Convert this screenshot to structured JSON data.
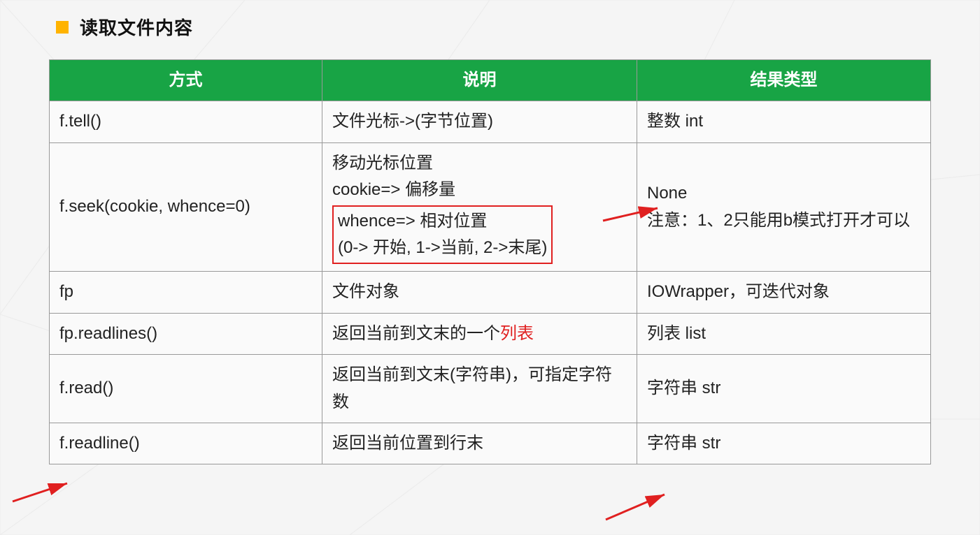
{
  "title": "读取文件内容",
  "headers": {
    "method": "方式",
    "desc": "说明",
    "type": "结果类型"
  },
  "rows": [
    {
      "method": "f.tell()",
      "desc_plain": "文件光标->(字节位置)",
      "type": "整数 int"
    },
    {
      "method": "f.seek(cookie, whence=0)",
      "desc_top": "移动光标位置\ncookie=> 偏移量",
      "desc_box": "whence=> 相对位置\n(0-> 开始, 1->当前, 2->末尾)",
      "type": "None\n注意：1、2只能用b模式打开才可以"
    },
    {
      "method": "fp",
      "desc_plain": "文件对象",
      "type": "IOWrapper，可迭代对象"
    },
    {
      "method": "fp.readlines()",
      "desc_prefix": "返回当前到文末的一个",
      "desc_red": "列表",
      "type": "列表 list"
    },
    {
      "method": "f.read()",
      "desc_plain": "返回当前到文末(字符串)，可指定字符数",
      "type": "字符串 str"
    },
    {
      "method": "f.readline()",
      "desc_plain": "返回当前位置到行末",
      "type": "字符串 str"
    }
  ]
}
